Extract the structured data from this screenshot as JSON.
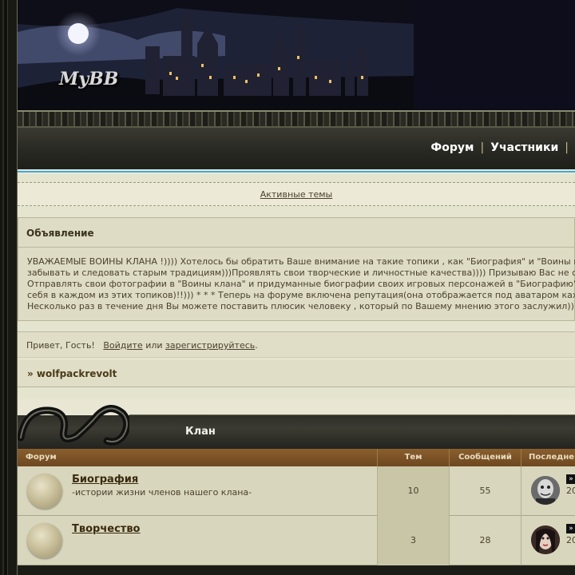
{
  "header": {
    "logo": "MyBB"
  },
  "nav": {
    "forum": "Форум",
    "members": "Участники",
    "separator": "|"
  },
  "active_topics": "Активные темы",
  "announcement": {
    "title": "Объявление",
    "lines": [
      "УВАЖАЕМЫЕ ВОИНЫ КЛАНА !)))) Хотелось бы обратить Ваше внимание на такие топики , как \"Биография\" и \"Воины к",
      "забывать и следовать старым традициям)))Проявлять свои творческие и личностные качества)))) Призываю Вас не с",
      "Отправлять свои фотографии в \"Воины клана\" и придуманные биографии своих игровых персонажей в \"Биографию\"",
      "себя в каждом из этих топиков)!!))) * * * Теперь на форуме включена репутация(она отображается под аватаром ках",
      "Несколько раз в течение дня Вы можете поставить плюсик человеку , который по Вашему мнению этого заслужил)))"
    ]
  },
  "guest": {
    "greeting": "Привет, Гость!",
    "login": "Войдите",
    "or": "или",
    "register": "зарегистрируйтесь",
    "dot": "."
  },
  "breadcrumb": "» wolfpackrevolt",
  "category": {
    "title": "Клан"
  },
  "table": {
    "headers": {
      "forum": "Форум",
      "topics": "Тем",
      "posts": "Сообщений",
      "last": "Последне"
    },
    "rows": [
      {
        "name": "Биография",
        "desc": "-истории жизни членов нашего клана-",
        "topics": "10",
        "posts": "55",
        "last_go": "»",
        "last_text": "20"
      },
      {
        "name": "Творчество",
        "desc": "",
        "topics": "3",
        "posts": "28",
        "last_go": "»",
        "last_text": "20"
      }
    ]
  }
}
